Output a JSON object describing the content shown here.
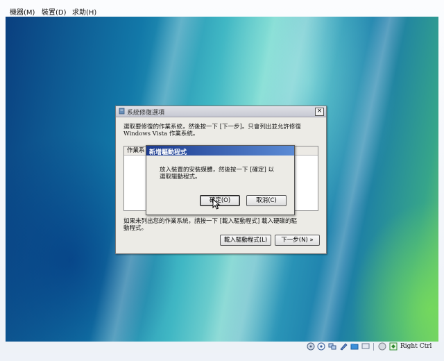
{
  "menu": {
    "items": [
      "機器(M)",
      "裝置(D)",
      "求助(H)"
    ]
  },
  "main_dialog": {
    "title": "系統修復選項",
    "close_label": "×",
    "instruction_line1": "選取要修復的作業系統，然後按一下 [下一步]。只會列出並允許修復",
    "instruction_line2": "Windows Vista 作業系統。",
    "list_header": "作業系",
    "note_line1": "如果未列出您的作業系統，請按一下 [載入驅動程式] 載入硬碟的驅",
    "note_line2": "動程式。",
    "load_driver_button": "載入驅動程式(L)",
    "next_button": "下一步(N) »"
  },
  "sub_dialog": {
    "title": "新增驅動程式",
    "message_line1": "放入裝置的安裝媒體，然後按一下 [確定] 以",
    "message_line2": "選取驅動程式。",
    "ok_button": "確定(O)",
    "cancel_button": "取消(C)"
  },
  "statusbar": {
    "host_key": "Right Ctrl",
    "icons": [
      "disk-icon",
      "cd-icon",
      "network-icon",
      "usb-icon",
      "shared-folder-icon",
      "display-icon",
      "mouse-integration-icon",
      "vm-state-icon"
    ]
  },
  "colors": {
    "sub_title_start": "#1c3a8e",
    "sub_title_end": "#5b8bd5",
    "dialog_bg": "#ecebe6"
  }
}
